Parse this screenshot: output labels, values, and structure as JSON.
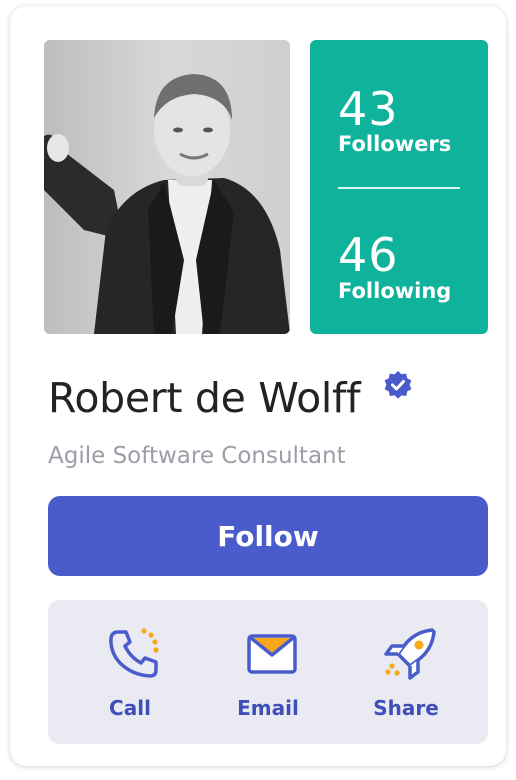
{
  "profile": {
    "name": "Robert de Wolff",
    "role": "Agile Software Consultant",
    "verified": true
  },
  "stats": {
    "followers_count": "43",
    "followers_label": "Followers",
    "following_count": "46",
    "following_label": "Following"
  },
  "follow_button": {
    "label": "Follow"
  },
  "actions": [
    {
      "label": "Call",
      "icon": "phone-icon"
    },
    {
      "label": "Email",
      "icon": "envelope-icon"
    },
    {
      "label": "Share",
      "icon": "rocket-icon"
    }
  ],
  "colors": {
    "stats_bg": "#0fb39b",
    "button_bg": "#4a5ccb",
    "accent_orange": "#f7a81b",
    "actions_bg": "#e9eaf2"
  }
}
